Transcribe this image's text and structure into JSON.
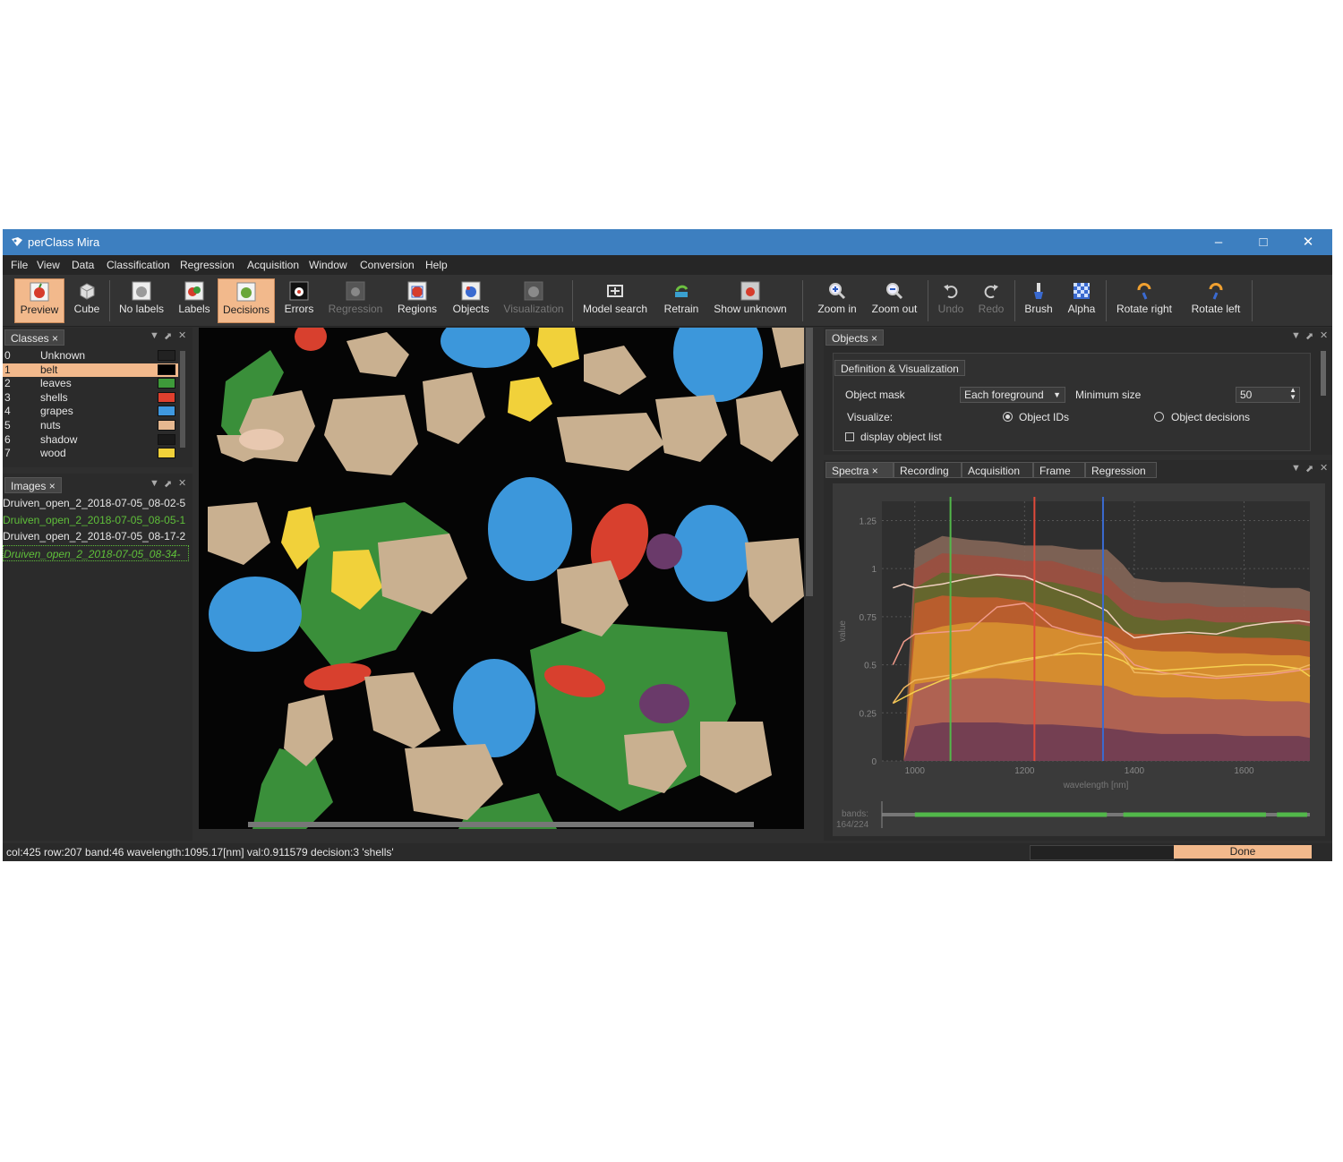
{
  "window": {
    "title": "perClass Mira",
    "minimize": "–",
    "maximize": "□",
    "close": "✕"
  },
  "menu": [
    "File",
    "View",
    "Data",
    "Classification",
    "Regression",
    "Acquisition",
    "Window",
    "Conversion",
    "Help"
  ],
  "toolbar": {
    "preview": "Preview",
    "cube": "Cube",
    "no_labels": "No labels",
    "labels": "Labels",
    "decisions": "Decisions",
    "errors": "Errors",
    "regression": "Regression",
    "regions": "Regions",
    "objects": "Objects",
    "visualization": "Visualization",
    "model_search": "Model search",
    "retrain": "Retrain",
    "show_unknown": "Show unknown",
    "zoom_in": "Zoom in",
    "zoom_out": "Zoom out",
    "undo": "Undo",
    "redo": "Redo",
    "brush": "Brush",
    "alpha": "Alpha",
    "rotate_right": "Rotate right",
    "rotate_left": "Rotate left"
  },
  "classes_panel": {
    "tab": "Classes",
    "close": "×",
    "items": [
      {
        "id": "0",
        "name": "Unknown",
        "color": "#222222",
        "selected": false
      },
      {
        "id": "1",
        "name": "belt",
        "color": "#000000",
        "selected": true
      },
      {
        "id": "2",
        "name": "leaves",
        "color": "#3e9a3a",
        "selected": false
      },
      {
        "id": "3",
        "name": "shells",
        "color": "#e0402e",
        "selected": false
      },
      {
        "id": "4",
        "name": "grapes",
        "color": "#3f98df",
        "selected": false
      },
      {
        "id": "5",
        "name": "nuts",
        "color": "#e6b890",
        "selected": false
      },
      {
        "id": "6",
        "name": "shadow",
        "color": "#1a1a1a",
        "selected": false
      },
      {
        "id": "7",
        "name": "wood",
        "color": "#f1d13a",
        "selected": false
      }
    ]
  },
  "images_panel": {
    "tab": "Images",
    "close": "×",
    "items": [
      {
        "name": "Druiven_open_2_2018-07-05_08-02-5",
        "color": "#e6e6e6",
        "selected": false
      },
      {
        "name": "Druiven_open_2_2018-07-05_08-05-1",
        "color": "#5fbf3a",
        "selected": false
      },
      {
        "name": "Druiven_open_2_2018-07-05_08-17-2",
        "color": "#e6e6e6",
        "selected": false
      },
      {
        "name": "Druiven_open_2_2018-07-05_08-34-",
        "color": "#5fbf3a",
        "selected": true
      }
    ]
  },
  "objects_panel": {
    "tab": "Objects",
    "close": "×",
    "subtab": "Definition & Visualization",
    "object_mask_label": "Object mask",
    "object_mask_value": "Each foreground",
    "minimum_size_label": "Minimum  size",
    "minimum_size_value": "50",
    "visualize_label": "Visualize:",
    "option_ids": "Object IDs",
    "option_decisions": "Object decisions",
    "display_list": "display object list"
  },
  "spectra_tabs": [
    {
      "label": "Spectra",
      "close": "×",
      "active": true
    },
    {
      "label": "Recording",
      "active": false
    },
    {
      "label": "Acquisition",
      "active": false
    },
    {
      "label": "Frame",
      "active": false
    },
    {
      "label": "Regression",
      "active": false
    }
  ],
  "chart_data": {
    "type": "area",
    "ylabel": "value",
    "xlabel": "wavelength [nm]",
    "xlim": [
      940,
      1720
    ],
    "ylim": [
      0,
      1.35
    ],
    "yticks": [
      "0",
      "0.25",
      "0.5",
      "0.75",
      "1",
      "1.25"
    ],
    "xticks": [
      "1000",
      "1200",
      "1400",
      "1600"
    ],
    "x": [
      960,
      980,
      1000,
      1050,
      1100,
      1150,
      1200,
      1250,
      1300,
      1350,
      1380,
      1400,
      1450,
      1500,
      1550,
      1600,
      1650,
      1700,
      1720
    ],
    "bands": [
      {
        "color": "#8a6a5a",
        "upper": [
          0.0,
          0.0,
          1.1,
          1.17,
          1.15,
          1.14,
          1.12,
          1.12,
          1.1,
          1.1,
          1.02,
          0.95,
          0.93,
          0.93,
          0.92,
          0.91,
          0.9,
          0.9,
          0.88
        ]
      },
      {
        "color": "#9d4e3e",
        "upper": [
          0.0,
          0.0,
          1.0,
          1.08,
          1.07,
          1.06,
          1.04,
          1.04,
          1.0,
          0.96,
          0.88,
          0.84,
          0.82,
          0.82,
          0.8,
          0.8,
          0.8,
          0.79,
          0.78
        ]
      },
      {
        "color": "#5c6a2a",
        "upper": [
          0.0,
          0.0,
          0.9,
          0.98,
          0.97,
          0.96,
          0.94,
          0.93,
          0.9,
          0.86,
          0.78,
          0.75,
          0.73,
          0.74,
          0.72,
          0.72,
          0.72,
          0.71,
          0.7
        ]
      },
      {
        "color": "#c75c2e",
        "upper": [
          0.0,
          0.0,
          0.82,
          0.86,
          0.85,
          0.85,
          0.83,
          0.8,
          0.76,
          0.72,
          0.68,
          0.66,
          0.66,
          0.66,
          0.65,
          0.64,
          0.64,
          0.63,
          0.62
        ]
      },
      {
        "color": "#d99430",
        "upper": [
          0.0,
          0.0,
          0.66,
          0.7,
          0.72,
          0.72,
          0.71,
          0.69,
          0.67,
          0.64,
          0.6,
          0.58,
          0.57,
          0.57,
          0.56,
          0.56,
          0.55,
          0.55,
          0.54
        ]
      },
      {
        "color": "#a85a58",
        "upper": [
          0.0,
          0.0,
          0.4,
          0.42,
          0.43,
          0.43,
          0.42,
          0.41,
          0.4,
          0.39,
          0.36,
          0.34,
          0.33,
          0.33,
          0.32,
          0.32,
          0.31,
          0.31,
          0.3
        ]
      },
      {
        "color": "#6a3a52",
        "upper": [
          0.0,
          0.0,
          0.18,
          0.2,
          0.2,
          0.2,
          0.19,
          0.19,
          0.18,
          0.17,
          0.16,
          0.15,
          0.14,
          0.14,
          0.14,
          0.13,
          0.13,
          0.13,
          0.12
        ]
      }
    ],
    "series": [
      {
        "color": "#f2d0c0",
        "values": [
          0.9,
          0.92,
          0.9,
          0.92,
          0.95,
          0.97,
          0.96,
          0.9,
          0.85,
          0.78,
          0.68,
          0.64,
          0.66,
          0.67,
          0.66,
          0.7,
          0.72,
          0.73,
          0.72
        ]
      },
      {
        "color": "#f09a8a",
        "values": [
          0.5,
          0.62,
          0.66,
          0.67,
          0.68,
          0.8,
          0.82,
          0.7,
          0.66,
          0.64,
          0.56,
          0.5,
          0.46,
          0.44,
          0.43,
          0.44,
          0.45,
          0.47,
          0.48
        ]
      },
      {
        "color": "#f5d050",
        "values": [
          0.3,
          0.33,
          0.36,
          0.42,
          0.47,
          0.5,
          0.53,
          0.55,
          0.56,
          0.55,
          0.52,
          0.48,
          0.47,
          0.48,
          0.49,
          0.5,
          0.5,
          0.48,
          0.44
        ]
      },
      {
        "color": "#f0b860",
        "values": [
          0.3,
          0.38,
          0.42,
          0.44,
          0.46,
          0.5,
          0.52,
          0.55,
          0.6,
          0.62,
          0.55,
          0.46,
          0.45,
          0.46,
          0.44,
          0.45,
          0.46,
          0.48,
          0.5
        ]
      }
    ],
    "markers": [
      {
        "x": 1065,
        "color": "#52b84a"
      },
      {
        "x": 1218,
        "color": "#e04a3a"
      },
      {
        "x": 1343,
        "color": "#3a6ad0"
      }
    ],
    "bands_label": "bands:",
    "bands_count": "164/224"
  },
  "status": {
    "text": "col:425 row:207 band:46 wavelength:1095.17[nm] val:0.911579 decision:3 'shells'",
    "done": "Done"
  }
}
